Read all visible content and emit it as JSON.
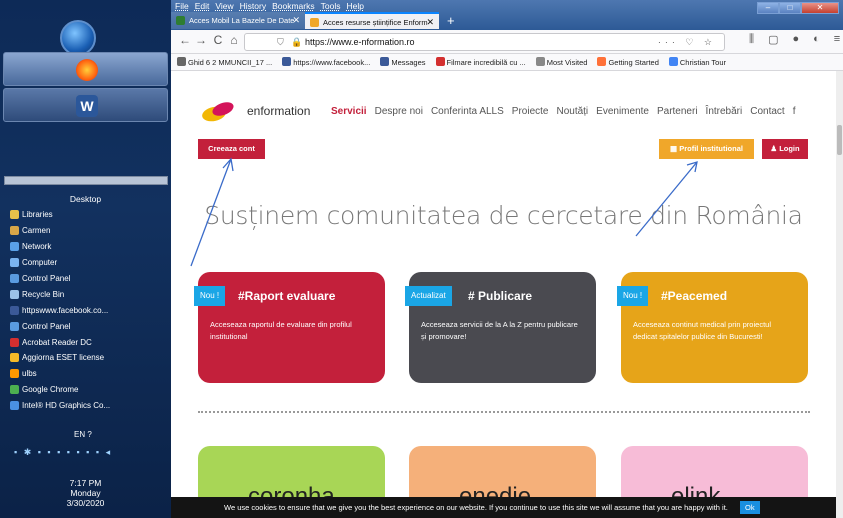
{
  "taskbar": {
    "desktop_title": "Desktop",
    "items": [
      "Libraries",
      "Carmen",
      "Network",
      "Computer",
      "Control Panel",
      "Recycle Bin",
      "httpswww.facebook.co...",
      "Control Panel",
      "Acrobat Reader DC",
      "Aggiorna ESET license",
      "ulbs",
      "Google Chrome",
      "Intel® HD Graphics Co..."
    ],
    "item_colors": [
      "#e8c24a",
      "#d8a648",
      "#5aa0e8",
      "#7ab3f0",
      "#5a9be0",
      "#9bc1e8",
      "#3b5998",
      "#5a9be0",
      "#d32f2f",
      "#f5b928",
      "#ff9800",
      "#4caf50",
      "#4a90e2"
    ],
    "lang": "EN",
    "clock": {
      "time": "7:17 PM",
      "day": "Monday",
      "date": "3/30/2020"
    },
    "word_label": "W"
  },
  "browser": {
    "menu": [
      "File",
      "Edit",
      "View",
      "History",
      "Bookmarks",
      "Tools",
      "Help"
    ],
    "tabs": [
      {
        "title": "Acces Mobil La Bazele De Date",
        "color": "#2e7d32"
      },
      {
        "title": "Acces resurse științifice Enform",
        "color": "#f0a72a"
      }
    ],
    "new_tab": "+",
    "window_controls": {
      "minimize": "–",
      "maximize": "□",
      "close": "✕"
    },
    "nav": {
      "back": "←",
      "forward": "→",
      "reload": "C",
      "home": "⌂"
    },
    "url": "https://www.e-nformation.ro",
    "url_actions": "··· ♡ ☆",
    "bookmarks": [
      {
        "label": "Ghid 6 2 MMUNCII_17 ...",
        "color": "#666"
      },
      {
        "label": "https://www.facebook...",
        "color": "#3b5998"
      },
      {
        "label": "Messages",
        "color": "#3b5998"
      },
      {
        "label": "Filmare incredibilă cu ...",
        "color": "#d32f2f"
      },
      {
        "label": "Most Visited",
        "color": "#888"
      },
      {
        "label": "Getting Started",
        "color": "#ff7139"
      },
      {
        "label": "Christian Tour",
        "color": "#4285f4"
      }
    ]
  },
  "site": {
    "brand": "enformation",
    "nav": [
      "Servicii",
      "Despre noi",
      "Conferinta ALLS",
      "Proiecte",
      "Noutăți",
      "Evenimente",
      "Parteneri",
      "Întrebări",
      "Contact",
      "f"
    ],
    "active_nav": "Servicii",
    "buttons": {
      "create": "Creeaza cont",
      "profil": "Profil institutional",
      "login": "Login"
    },
    "hero": "Susținem comunitatea de cercetare din România",
    "cards": [
      {
        "badge": "Nou !",
        "title": "#Raport evaluare",
        "desc": "Acceseaza raportul de evaluare din profilul institutional"
      },
      {
        "badge": "Actualizat",
        "title": "# Publicare",
        "desc": "Acceseaza servicii de la A la Z pentru publicare și promovare!"
      },
      {
        "badge": "Nou !",
        "title": "#Peacemed",
        "desc": "Acceseaza continut medical prin proiectul dedicat spitalelor publice din Bucuresti!"
      }
    ],
    "cards_bottom": [
      "coronha",
      "enedie",
      "elink"
    ],
    "cookie": "We use cookies to ensure that we give you the best experience on our website. If you continue to use this site we will assume that you are happy with it.",
    "cookie_ok": "Ok"
  }
}
